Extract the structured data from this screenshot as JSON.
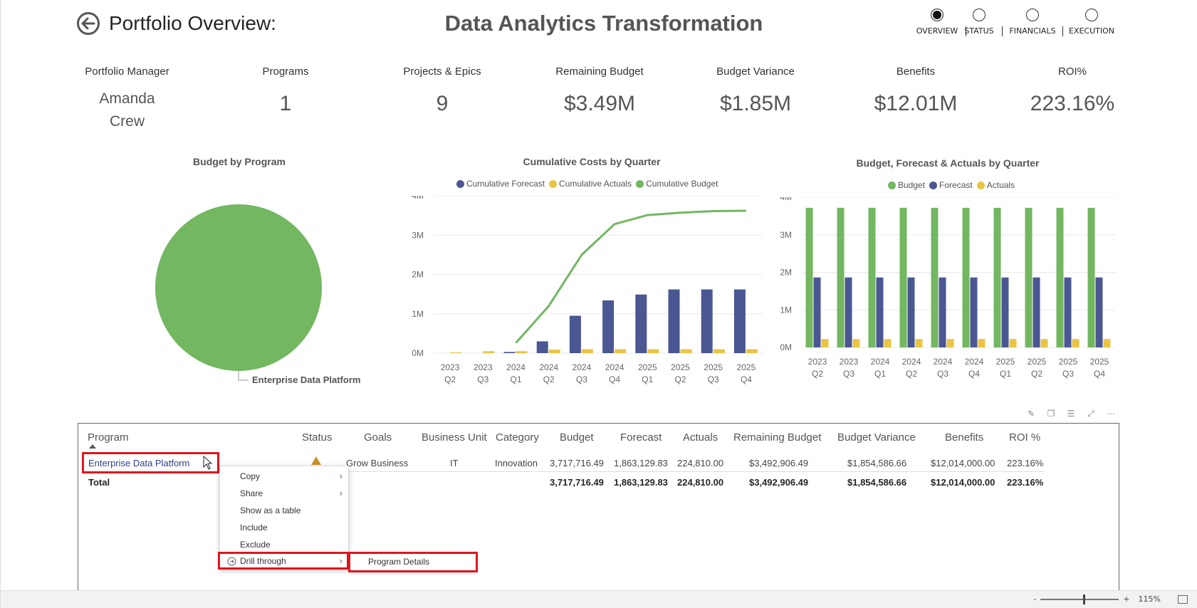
{
  "header": {
    "title_left": "Portfolio Overview:",
    "title_center": "Data Analytics Transformation"
  },
  "nav": [
    {
      "label": "OVERVIEW",
      "active": true
    },
    {
      "label": "STATUS",
      "active": false
    },
    {
      "label": "FINANCIALS",
      "active": false
    },
    {
      "label": "EXECUTION",
      "active": false
    }
  ],
  "kpis": {
    "manager": {
      "label": "Portfolio Manager",
      "value_line1": "Amanda",
      "value_line2": "Crew"
    },
    "programs": {
      "label": "Programs",
      "value": "1"
    },
    "projects": {
      "label": "Projects & Epics",
      "value": "9"
    },
    "remaining": {
      "label": "Remaining Budget",
      "value": "$3.49M"
    },
    "variance": {
      "label": "Budget Variance",
      "value": "$1.85M"
    },
    "benefits": {
      "label": "Benefits",
      "value": "$12.01M"
    },
    "roi": {
      "label": "ROI%",
      "value": "223.16%"
    }
  },
  "colors": {
    "budget": "#73b761",
    "forecast": "#4a5792",
    "actuals": "#eac443",
    "highlight": "#e0161e"
  },
  "chart_data": [
    {
      "type": "pie",
      "title": "Budget by Program",
      "categories": [
        "Enterprise Data Platform"
      ],
      "values": [
        3717716.49
      ]
    },
    {
      "type": "bar",
      "title": "Cumulative Costs by Quarter",
      "legend": [
        "Cumulative Forecast",
        "Cumulative Actuals",
        "Cumulative Budget"
      ],
      "categories": [
        "2023 Q2",
        "2023 Q3",
        "2024 Q1",
        "2024 Q2",
        "2024 Q3",
        "2024 Q4",
        "2025 Q1",
        "2025 Q2",
        "2025 Q3",
        "2025 Q4"
      ],
      "x_top": [
        "2023",
        "2023",
        "2024",
        "2024",
        "2024",
        "2024",
        "2025",
        "2025",
        "2025",
        "2025"
      ],
      "x_bottom": [
        "Q2",
        "Q3",
        "Q1",
        "Q2",
        "Q3",
        "Q4",
        "Q1",
        "Q2",
        "Q3",
        "Q4"
      ],
      "yticks": [
        "0M",
        "1M",
        "2M",
        "3M",
        "4M"
      ],
      "ylim": [
        0,
        4000000
      ],
      "series": [
        {
          "name": "Cumulative Forecast",
          "kind": "bar",
          "values": [
            0,
            0,
            30000,
            300000,
            950000,
            1340000,
            1490000,
            1620000,
            1620000,
            1620000
          ]
        },
        {
          "name": "Cumulative Actuals",
          "kind": "bar",
          "values": [
            20000,
            50000,
            50000,
            90000,
            100000,
            100000,
            100000,
            100000,
            100000,
            100000
          ]
        },
        {
          "name": "Cumulative Budget",
          "kind": "line",
          "values": [
            null,
            null,
            260000,
            1200000,
            2500000,
            3280000,
            3510000,
            3570000,
            3610000,
            3620000
          ]
        }
      ]
    },
    {
      "type": "bar",
      "title": "Budget, Forecast & Actuals by Quarter",
      "legend": [
        "Budget",
        "Forecast",
        "Actuals"
      ],
      "categories": [
        "2023 Q2",
        "2023 Q3",
        "2024 Q1",
        "2024 Q2",
        "2024 Q3",
        "2024 Q4",
        "2025 Q1",
        "2025 Q2",
        "2025 Q3",
        "2025 Q4"
      ],
      "x_top": [
        "2023",
        "2023",
        "2024",
        "2024",
        "2024",
        "2024",
        "2025",
        "2025",
        "2025",
        "2025"
      ],
      "x_bottom": [
        "Q2",
        "Q3",
        "Q1",
        "Q2",
        "Q3",
        "Q4",
        "Q1",
        "Q2",
        "Q3",
        "Q4"
      ],
      "yticks": [
        "0M",
        "1M",
        "2M",
        "3M",
        "4M"
      ],
      "ylim": [
        0,
        4000000
      ],
      "series": [
        {
          "name": "Budget",
          "values": [
            3717716,
            3717716,
            3717716,
            3717716,
            3717716,
            3717716,
            3717716,
            3717716,
            3717716,
            3717716
          ]
        },
        {
          "name": "Forecast",
          "values": [
            1863130,
            1863130,
            1863130,
            1863130,
            1863130,
            1863130,
            1863130,
            1863130,
            1863130,
            1863130
          ]
        },
        {
          "name": "Actuals",
          "values": [
            224810,
            224810,
            224810,
            224810,
            224810,
            224810,
            224810,
            224810,
            224810,
            224810
          ]
        }
      ]
    }
  ],
  "table": {
    "headers": [
      "Program",
      "Status",
      "Goals",
      "Business Unit",
      "Category",
      "Budget",
      "Forecast",
      "Actuals",
      "Remaining Budget",
      "Budget Variance",
      "Benefits",
      "ROI %"
    ],
    "row": {
      "program": "Enterprise Data Platform",
      "goals": "Grow Business",
      "business_unit": "IT",
      "category": "Innovation",
      "budget": "3,717,716.49",
      "forecast": "1,863,129.83",
      "actuals": "224,810.00",
      "remaining": "$3,492,906.49",
      "variance": "$1,854,586.66",
      "benefits": "$12,014,000.00",
      "roi": "223.16%"
    },
    "total": {
      "label": "Total",
      "budget": "3,717,716.49",
      "forecast": "1,863,129.83",
      "actuals": "224,810.00",
      "remaining": "$3,492,906.49",
      "variance": "$1,854,586.66",
      "benefits": "$12,014,000.00",
      "roi": "223.16%"
    }
  },
  "context_menu": {
    "items": [
      "Copy",
      "Share",
      "Show as a table",
      "Include",
      "Exclude",
      "Drill through"
    ],
    "submenu_item": "Program Details"
  },
  "statusbar": {
    "zoom_minus": "-",
    "zoom_plus": "+",
    "zoom_level": "115%"
  }
}
